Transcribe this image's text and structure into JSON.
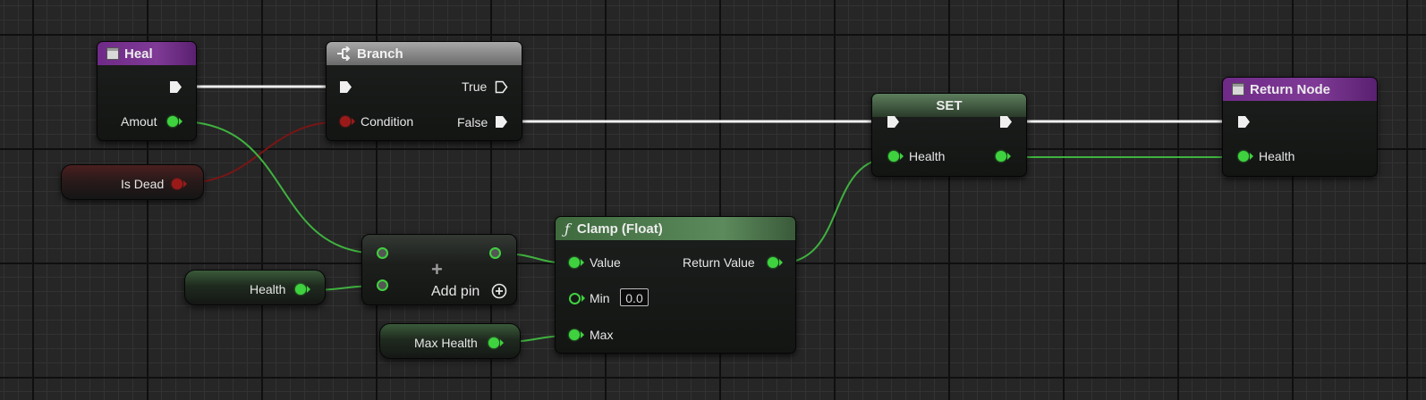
{
  "colors": {
    "exec": "#f0f0f0",
    "float": "#3fd23f",
    "bool": "#9a1a1a",
    "header_function": "#7f3a96",
    "header_pure": "#5c8a5c"
  },
  "nodes": {
    "heal": {
      "title": "Heal",
      "icon": "function-icon",
      "out_amount": "Amout"
    },
    "branch": {
      "title": "Branch",
      "icon": "branch-icon",
      "in_condition": "Condition",
      "out_true": "True",
      "out_false": "False"
    },
    "set": {
      "title": "SET",
      "in_health": "Health"
    },
    "return_node": {
      "title": "Return Node",
      "icon": "function-icon",
      "in_health": "Health"
    },
    "clamp": {
      "title": "Clamp (Float)",
      "icon": "f-icon",
      "in_value": "Value",
      "in_min": "Min",
      "min_value": "0.0",
      "in_max": "Max",
      "out_return": "Return Value"
    },
    "add": {
      "title": "+",
      "add_pin": "Add pin"
    }
  },
  "variables": {
    "is_dead": "Is Dead",
    "health": "Health",
    "max_health": "Max Health"
  }
}
